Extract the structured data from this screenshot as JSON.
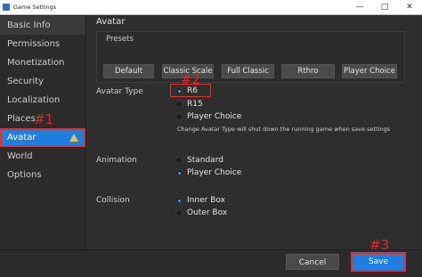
{
  "window": {
    "title": "Game Settings",
    "minimize": "—",
    "maximize": "□",
    "close": "✕"
  },
  "sidebar": {
    "items": [
      {
        "label": "Basic Info"
      },
      {
        "label": "Permissions"
      },
      {
        "label": "Monetization"
      },
      {
        "label": "Security"
      },
      {
        "label": "Localization"
      },
      {
        "label": "Places"
      },
      {
        "label": "Avatar"
      },
      {
        "label": "World"
      },
      {
        "label": "Options"
      }
    ]
  },
  "annotations": {
    "m1": "#1",
    "m2": "#2",
    "m3": "#3"
  },
  "main": {
    "title": "Avatar",
    "presets": {
      "label": "Presets",
      "buttons": [
        "Default",
        "Classic Scale",
        "Full Classic",
        "Rthro",
        "Player Choice"
      ]
    },
    "avatar_type": {
      "label": "Avatar Type",
      "options": [
        "R6",
        "R15",
        "Player Choice"
      ],
      "selected": "R6",
      "note": "Change Avatar Type will shut down the running game when save settings"
    },
    "animation": {
      "label": "Animation",
      "options": [
        "Standard",
        "Player Choice"
      ],
      "selected": "Player Choice"
    },
    "collision": {
      "label": "Collision",
      "options": [
        "Inner Box",
        "Outer Box"
      ],
      "selected": "Inner Box"
    }
  },
  "footer": {
    "cancel": "Cancel",
    "save": "Save"
  },
  "colors": {
    "accent": "#1f7fde",
    "annotation": "#e03030",
    "warning": "#f0c23c"
  }
}
